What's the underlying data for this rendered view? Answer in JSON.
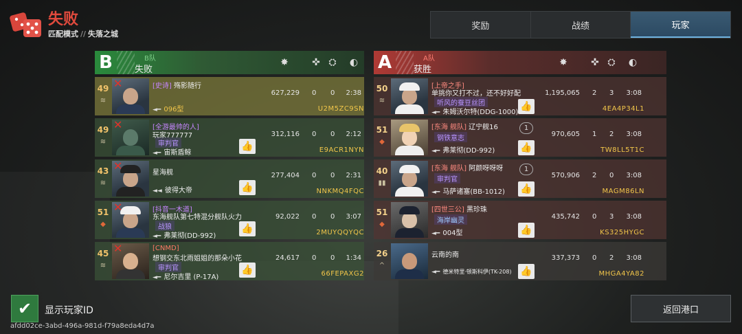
{
  "header": {
    "result": "失败",
    "mode": "匹配模式",
    "sep": "//",
    "map": "失落之城"
  },
  "tabs": [
    {
      "label": "奖励",
      "active": false
    },
    {
      "label": "战绩",
      "active": false
    },
    {
      "label": "玩家",
      "active": true
    }
  ],
  "column_icons": [
    "kills-icon",
    "assist-icon",
    "support-icon",
    "time-icon"
  ],
  "team_b": {
    "letter": "B",
    "name": "B队",
    "status": "失败",
    "players": [
      {
        "level": "49",
        "tag": "[史诗]",
        "name": "殇影随行",
        "title": "",
        "ship": "096型",
        "score": "627,229",
        "kills": "0",
        "assists": "0",
        "time": "2:38",
        "id": "U2M5ZC9SN",
        "like": false,
        "dead": true
      },
      {
        "level": "49",
        "tag": "[全游最帅的人]",
        "name": "玩家777777",
        "title": "审判官",
        "ship": "宙斯盾鲸",
        "score": "312,116",
        "kills": "0",
        "assists": "0",
        "time": "2:12",
        "id": "E9ACR1NYN",
        "like": true,
        "dead": true
      },
      {
        "level": "43",
        "tag": "",
        "name": "星海舰",
        "title": "",
        "ship": "彼得大帝",
        "score": "277,404",
        "kills": "0",
        "assists": "0",
        "time": "2:31",
        "id": "NNKMQ4FQC",
        "like": true,
        "dead": true
      },
      {
        "level": "51",
        "tag": "[抖音一木道]",
        "name": "东海舰队第七特混分舰队火力",
        "title": "战狼",
        "ship": "弗莱彻(DD-992)",
        "score": "92,022",
        "kills": "0",
        "assists": "0",
        "time": "3:07",
        "id": "2MUYQQYQC",
        "like": true,
        "dead": true
      },
      {
        "level": "45",
        "tag": "[CNMD]",
        "name": "想钢交东北雨姐姐的那朵小花",
        "title": "审判官",
        "ship": "尼尔吉里 (P-17A)",
        "score": "24,617",
        "kills": "0",
        "assists": "0",
        "time": "1:34",
        "id": "66FEPAXG2",
        "like": true,
        "dead": true
      }
    ]
  },
  "team_a": {
    "letter": "A",
    "name": "A队",
    "status": "获胜",
    "players": [
      {
        "level": "50",
        "tag": "[上帝之手]",
        "name": "单挑你又打不过，还不好好配",
        "title": "听风的蚕豆丝团",
        "ship": "朱姆沃尔特(DDG-1000)",
        "score": "1,195,065",
        "kills": "2",
        "assists": "3",
        "time": "3:08",
        "id": "4EA4P34L1",
        "like": true,
        "pill": ""
      },
      {
        "level": "51",
        "tag": "[东海 舰队]",
        "name": "辽宁舰16",
        "title": "钢铁意志",
        "ship": "弗莱彻(DD-992)",
        "score": "970,605",
        "kills": "1",
        "assists": "2",
        "time": "3:08",
        "id": "TW8LL5T1C",
        "like": true,
        "pill": "1"
      },
      {
        "level": "40",
        "tag": "[东海 舰队]",
        "name": "阿颜呀呀呀",
        "title": "审判官",
        "ship": "马萨诸塞(BB-1012)",
        "score": "570,906",
        "kills": "2",
        "assists": "0",
        "time": "3:08",
        "id": "MAGM86LN",
        "like": true,
        "pill": "1"
      },
      {
        "level": "51",
        "tag": "[四世三公]",
        "name": "黑珍珠",
        "title": "海岸幽灵",
        "ship": "004型",
        "score": "435,742",
        "kills": "0",
        "assists": "3",
        "time": "3:08",
        "id": "KS325HYGC",
        "like": true,
        "pill": ""
      },
      {
        "level": "26",
        "tag": "",
        "name": "云南的南",
        "title": "",
        "ship": "德米特里·顿斯科伊(TK-208)",
        "score": "337,373",
        "kills": "0",
        "assists": "2",
        "time": "3:08",
        "id": "MHGA4YA82",
        "like": true,
        "pill": ""
      }
    ]
  },
  "footer": {
    "toggle_label": "显示玩家ID",
    "toggle_checked": true,
    "uuid": "afdd02ce-3abd-496a-981d-f79a8eda4d7a",
    "return_label": "返回港口"
  }
}
